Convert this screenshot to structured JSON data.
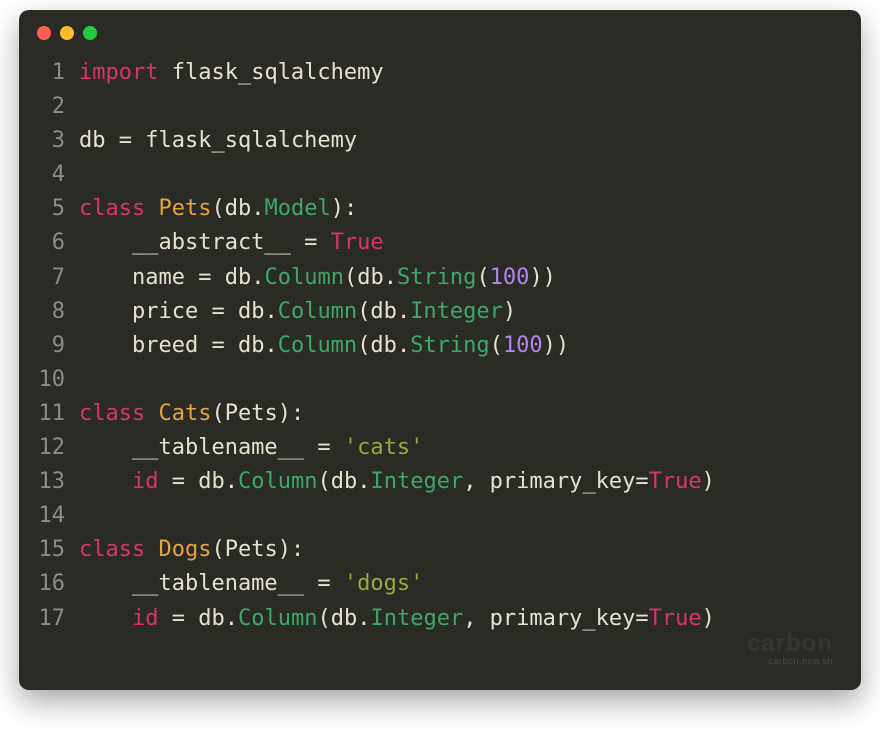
{
  "watermark": {
    "brand": "carbon",
    "url": "carbon.now.sh"
  },
  "traffic_lights": [
    "red",
    "yellow",
    "green"
  ],
  "code": {
    "lines": [
      {
        "n": 1,
        "tokens": [
          {
            "t": "import",
            "c": "kw"
          },
          {
            "t": " flask_sqlalchemy",
            "c": "def"
          }
        ]
      },
      {
        "n": 2,
        "tokens": []
      },
      {
        "n": 3,
        "tokens": [
          {
            "t": "db ",
            "c": "def"
          },
          {
            "t": "=",
            "c": "op"
          },
          {
            "t": " flask_sqlalchemy",
            "c": "def"
          }
        ]
      },
      {
        "n": 4,
        "tokens": []
      },
      {
        "n": 5,
        "tokens": [
          {
            "t": "class ",
            "c": "kw"
          },
          {
            "t": "Pets",
            "c": "cls"
          },
          {
            "t": "(db",
            "c": "def"
          },
          {
            "t": ".",
            "c": "dot"
          },
          {
            "t": "Model",
            "c": "mem"
          },
          {
            "t": "):",
            "c": "def"
          }
        ]
      },
      {
        "n": 6,
        "tokens": [
          {
            "t": "    __abstract__ ",
            "c": "def"
          },
          {
            "t": "=",
            "c": "op"
          },
          {
            "t": " ",
            "c": "def"
          },
          {
            "t": "True",
            "c": "bool"
          }
        ]
      },
      {
        "n": 7,
        "tokens": [
          {
            "t": "    name ",
            "c": "def"
          },
          {
            "t": "=",
            "c": "op"
          },
          {
            "t": " db",
            "c": "def"
          },
          {
            "t": ".",
            "c": "dot"
          },
          {
            "t": "Column",
            "c": "mem"
          },
          {
            "t": "(db",
            "c": "def"
          },
          {
            "t": ".",
            "c": "dot"
          },
          {
            "t": "String",
            "c": "type"
          },
          {
            "t": "(",
            "c": "def"
          },
          {
            "t": "100",
            "c": "num"
          },
          {
            "t": "))",
            "c": "def"
          }
        ]
      },
      {
        "n": 8,
        "tokens": [
          {
            "t": "    price ",
            "c": "def"
          },
          {
            "t": "=",
            "c": "op"
          },
          {
            "t": " db",
            "c": "def"
          },
          {
            "t": ".",
            "c": "dot"
          },
          {
            "t": "Column",
            "c": "mem"
          },
          {
            "t": "(db",
            "c": "def"
          },
          {
            "t": ".",
            "c": "dot"
          },
          {
            "t": "Integer",
            "c": "type"
          },
          {
            "t": ")",
            "c": "def"
          }
        ]
      },
      {
        "n": 9,
        "tokens": [
          {
            "t": "    breed ",
            "c": "def"
          },
          {
            "t": "=",
            "c": "op"
          },
          {
            "t": " db",
            "c": "def"
          },
          {
            "t": ".",
            "c": "dot"
          },
          {
            "t": "Column",
            "c": "mem"
          },
          {
            "t": "(db",
            "c": "def"
          },
          {
            "t": ".",
            "c": "dot"
          },
          {
            "t": "String",
            "c": "type"
          },
          {
            "t": "(",
            "c": "def"
          },
          {
            "t": "100",
            "c": "num"
          },
          {
            "t": "))",
            "c": "def"
          }
        ]
      },
      {
        "n": 10,
        "tokens": []
      },
      {
        "n": 11,
        "tokens": [
          {
            "t": "class ",
            "c": "kw"
          },
          {
            "t": "Cats",
            "c": "cls"
          },
          {
            "t": "(Pets):",
            "c": "def"
          }
        ]
      },
      {
        "n": 12,
        "tokens": [
          {
            "t": "    __tablename__ ",
            "c": "def"
          },
          {
            "t": "=",
            "c": "op"
          },
          {
            "t": " ",
            "c": "def"
          },
          {
            "t": "'cats'",
            "c": "str"
          }
        ]
      },
      {
        "n": 13,
        "tokens": [
          {
            "t": "    ",
            "c": "def"
          },
          {
            "t": "id",
            "c": "id"
          },
          {
            "t": " ",
            "c": "def"
          },
          {
            "t": "=",
            "c": "op"
          },
          {
            "t": " db",
            "c": "def"
          },
          {
            "t": ".",
            "c": "dot"
          },
          {
            "t": "Column",
            "c": "mem"
          },
          {
            "t": "(db",
            "c": "def"
          },
          {
            "t": ".",
            "c": "dot"
          },
          {
            "t": "Integer",
            "c": "type"
          },
          {
            "t": ", primary_key",
            "c": "def"
          },
          {
            "t": "=",
            "c": "op"
          },
          {
            "t": "True",
            "c": "bool"
          },
          {
            "t": ")",
            "c": "def"
          }
        ]
      },
      {
        "n": 14,
        "tokens": []
      },
      {
        "n": 15,
        "tokens": [
          {
            "t": "class ",
            "c": "kw"
          },
          {
            "t": "Dogs",
            "c": "cls"
          },
          {
            "t": "(Pets):",
            "c": "def"
          }
        ]
      },
      {
        "n": 16,
        "tokens": [
          {
            "t": "    __tablename__ ",
            "c": "def"
          },
          {
            "t": "=",
            "c": "op"
          },
          {
            "t": " ",
            "c": "def"
          },
          {
            "t": "'dogs'",
            "c": "str"
          }
        ]
      },
      {
        "n": 17,
        "tokens": [
          {
            "t": "    ",
            "c": "def"
          },
          {
            "t": "id",
            "c": "id"
          },
          {
            "t": " ",
            "c": "def"
          },
          {
            "t": "=",
            "c": "op"
          },
          {
            "t": " db",
            "c": "def"
          },
          {
            "t": ".",
            "c": "dot"
          },
          {
            "t": "Column",
            "c": "mem"
          },
          {
            "t": "(db",
            "c": "def"
          },
          {
            "t": ".",
            "c": "dot"
          },
          {
            "t": "Integer",
            "c": "type"
          },
          {
            "t": ", primary_key",
            "c": "def"
          },
          {
            "t": "=",
            "c": "op"
          },
          {
            "t": "True",
            "c": "bool"
          },
          {
            "t": ")",
            "c": "def"
          }
        ]
      }
    ]
  }
}
